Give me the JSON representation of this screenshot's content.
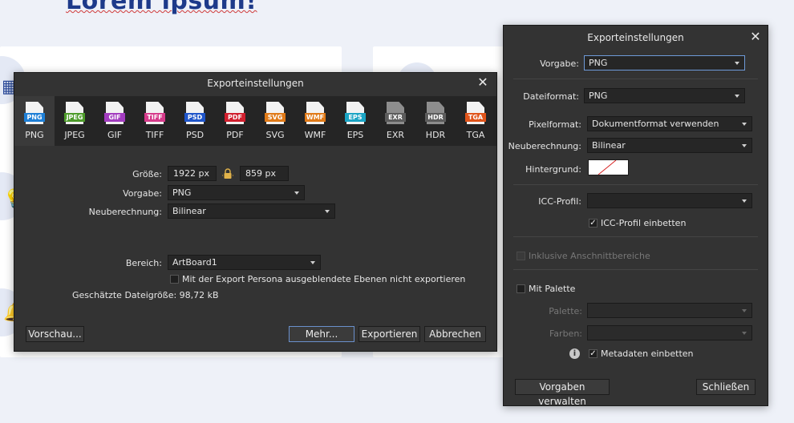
{
  "background_page": {
    "heading": "Lorem ipsum!"
  },
  "left_dialog": {
    "title": "Exporteinstellungen",
    "formats": [
      {
        "label": "PNG",
        "color": "#1e7fd6",
        "selected": true
      },
      {
        "label": "JPEG",
        "color": "#4d9b2a",
        "selected": false
      },
      {
        "label": "GIF",
        "color": "#a23cbf",
        "selected": false
      },
      {
        "label": "TIFF",
        "color": "#d63a8a",
        "selected": false
      },
      {
        "label": "PSD",
        "color": "#1f55c9",
        "selected": false
      },
      {
        "label": "PDF",
        "color": "#d11f2e",
        "selected": false
      },
      {
        "label": "SVG",
        "color": "#e07a18",
        "selected": false
      },
      {
        "label": "WMF",
        "color": "#e07a18",
        "selected": false
      },
      {
        "label": "EPS",
        "color": "#1aa4c4",
        "selected": false
      },
      {
        "label": "EXR",
        "color": "#5c5c5c",
        "selected": false
      },
      {
        "label": "HDR",
        "color": "#5c5c5c",
        "selected": false
      },
      {
        "label": "TGA",
        "color": "#e0541a",
        "selected": false
      }
    ],
    "size_label": "Größe:",
    "width_value": "1922 px",
    "height_value": "859 px",
    "preset_label": "Vorgabe:",
    "preset_value": "PNG",
    "resample_label": "Neuberechnung:",
    "resample_value": "Bilinear",
    "area_label": "Bereich:",
    "area_value": "ArtBoard1",
    "hidden_layers_checkbox_label": "Mit der Export Persona ausgeblendete Ebenen nicht exportieren",
    "hidden_layers_checked": false,
    "estimated_size": "Geschätzte Dateigröße: 98,72 kB",
    "preview_button": "Vorschau...",
    "more_button": "Mehr...",
    "export_button": "Exportieren",
    "cancel_button": "Abbrechen"
  },
  "right_dialog": {
    "title": "Exporteinstellungen",
    "preset_label": "Vorgabe:",
    "preset_value": "PNG",
    "file_format_label": "Dateiformat:",
    "file_format_value": "PNG",
    "pixel_format_label": "Pixelformat:",
    "pixel_format_value": "Dokumentformat verwenden",
    "resample_label": "Neuberechnung:",
    "resample_value": "Bilinear",
    "background_label": "Hintergrund:",
    "icc_profile_label": "ICC-Profil:",
    "icc_profile_value": "",
    "embed_icc_label": "ICC-Profil einbetten",
    "embed_icc_checked": true,
    "bleed_label": "Inklusive Anschnittbereiche",
    "bleed_checked": false,
    "palette_option_label": "Mit Palette",
    "palette_option_checked": false,
    "palette_label": "Palette:",
    "colors_label": "Farben:",
    "embed_metadata_label": "Metadaten einbetten",
    "embed_metadata_checked": true,
    "manage_presets_button": "Vorgaben verwalten",
    "close_button": "Schließen"
  }
}
